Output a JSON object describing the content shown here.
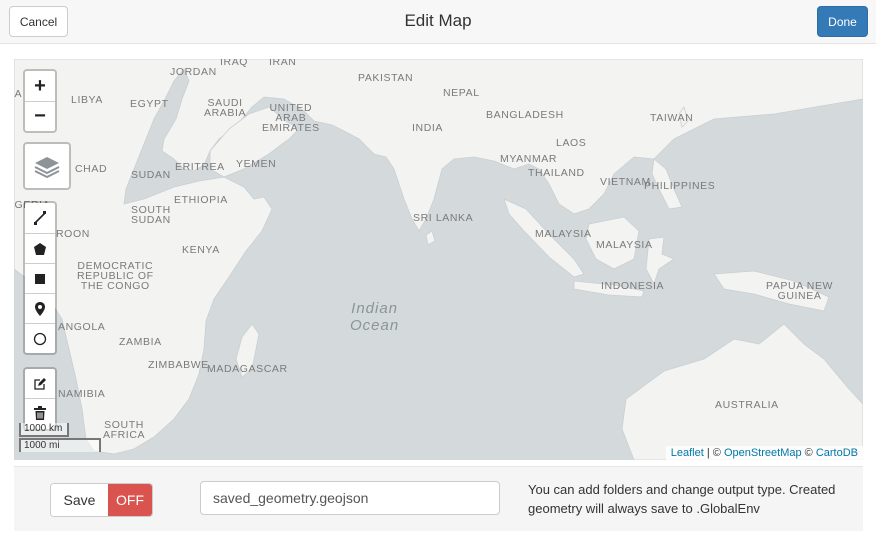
{
  "header": {
    "cancel_label": "Cancel",
    "title": "Edit Map",
    "done_label": "Done"
  },
  "map": {
    "ocean_label": "Indian\nOcean",
    "labels": {
      "jordan": "JORDAN",
      "iraq": "IRAQ",
      "iran": "IRAN",
      "pakistan": "PAKISTAN",
      "libya": "LIBYA",
      "egypt": "EGYPT",
      "saudi": "SAUDI\nARABIA",
      "uae": "UNITED\nARAB\nEMIRATES",
      "nepal": "NEPAL",
      "bangladesh": "BANGLADESH",
      "taiwan": "TAIWAN",
      "india": "INDIA",
      "laos": "LAOS",
      "myanmar": "MYANMAR",
      "thailand": "THAILAND",
      "vietnam": "VIETNAM",
      "philippines": "PHILIPPINES",
      "eritrea": "ERITREA",
      "yemen": "YEMEN",
      "chad": "CHAD",
      "sudan": "SUDAN",
      "ethiopia": "ETHIOPIA",
      "south_sudan": "SOUTH\nSUDAN",
      "srilanka": "SRI LANKA",
      "malaysia1": "MALAYSIA",
      "malaysia2": "MALAYSIA",
      "nigeria": "IGERIA",
      "cameroon": "ROON",
      "kenya": "KENYA",
      "drc": "DEMOCRATIC\nREPUBLIC OF\nTHE CONGO",
      "indonesia": "INDONESIA",
      "png": "PAPUA NEW\nGUINEA",
      "angola": "ANGOLA",
      "zambia": "ZAMBIA",
      "zimbabwe": "ZIMBABWE",
      "madagascar": "MADAGASCAR",
      "namibia": "NAMIBIA",
      "south_africa": "SOUTH\nAFRICA",
      "australia": "AUSTRALIA",
      "algeria": "IA"
    },
    "zoom_in": "+",
    "zoom_out": "−",
    "scale_km": "1000 km",
    "scale_mi": "1000 mi",
    "attribution": {
      "leaflet": "Leaflet",
      "sep1": " | © ",
      "osm": "OpenStreetMap",
      "sep2": " © ",
      "carto": "CartoDB"
    }
  },
  "footer": {
    "save_label": "Save",
    "toggle_state": "OFF",
    "filename_value": "saved_geometry.geojson",
    "note": "You can add folders and change output type. Created geometry will always save to .GlobalEnv"
  },
  "colors": {
    "done": "#337ab7",
    "toggle_off": "#d9534f",
    "water": "#d4dadc",
    "land": "#f2f2f0",
    "link": "#0078a8"
  }
}
